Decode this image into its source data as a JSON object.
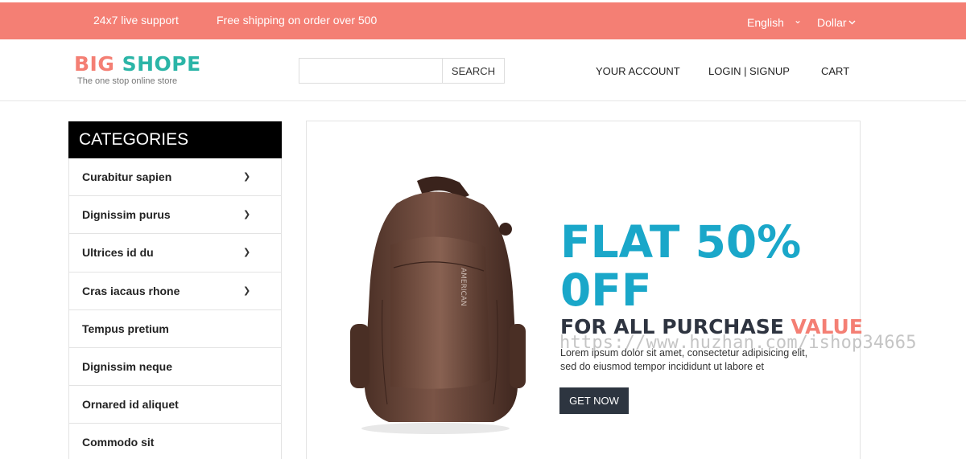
{
  "topbar": {
    "support": "24x7 live support",
    "shipping": "Free shipping on order over 500",
    "language": "English",
    "currency": "Dollar"
  },
  "header": {
    "logo_big": "BIG ",
    "logo_shope": "SHOPE",
    "tagline": "The one stop online store",
    "search_placeholder": "",
    "search_button": "SEARCH",
    "nav_account": "YOUR ACCOUNT",
    "nav_login": "LOGIN | SIGNUP",
    "nav_cart": "CART"
  },
  "sidebar": {
    "title": "CATEGORIES",
    "items": [
      {
        "label": "Curabitur sapien",
        "has_submenu": true
      },
      {
        "label": "Dignissim purus",
        "has_submenu": true
      },
      {
        "label": "Ultrices id du",
        "has_submenu": true
      },
      {
        "label": "Cras iacaus rhone",
        "has_submenu": true
      },
      {
        "label": "Tempus pretium",
        "has_submenu": false
      },
      {
        "label": "Dignissim neque",
        "has_submenu": false
      },
      {
        "label": "Ornared id aliquet",
        "has_submenu": false
      },
      {
        "label": "Commodo sit",
        "has_submenu": false
      }
    ]
  },
  "banner": {
    "headline_line1": "FLAT 50%",
    "headline_line2": "0FF",
    "subhead_main": "FOR ALL PURCHASE ",
    "subhead_accent": "VALUE",
    "description": "Lorem ipsum dolor sit amet, consectetur adipisicing elit, sed do eiusmod tempor incididunt ut labore et",
    "cta": "GET NOW",
    "image": "backpack-image"
  },
  "watermark": "https://www.huzhan.com/ishop34665",
  "colors": {
    "topbar": "#f47f74",
    "accent_blue": "#1aa7c9",
    "accent_teal": "#2bb5a7",
    "dark_button": "#2d3540"
  }
}
